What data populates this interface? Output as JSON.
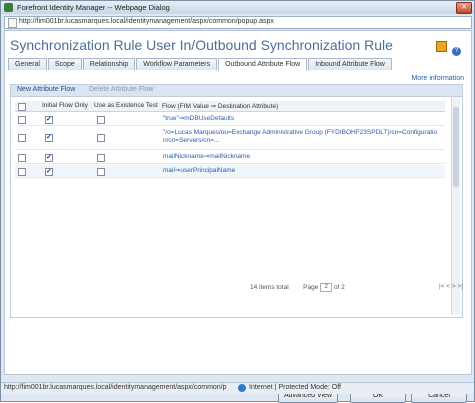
{
  "window": {
    "title": "Forefront Identity Manager -- Webpage Dialog",
    "address": "http://fim001br.lucasmarques.local/identitymanagement/aspx/common/popup.aspx",
    "close_glyph": "✕"
  },
  "page": {
    "heading": "Synchronization Rule User In/Outbound Synchronization Rule",
    "more_info": "More information"
  },
  "tabs": [
    {
      "label": "General"
    },
    {
      "label": "Scope"
    },
    {
      "label": "Relationship"
    },
    {
      "label": "Workflow Parameters"
    },
    {
      "label": "Outbound Attribute Flow",
      "active": true
    },
    {
      "label": "Inbound Attribute Flow"
    }
  ],
  "toolbar": {
    "new_label": "New Attribute Flow",
    "delete_label": "Delete Attribute Flow"
  },
  "grid": {
    "headers": {
      "initial": "Initial Flow Only",
      "existence": "Use as Existence Test",
      "flow": "Flow (FIM Value ⇒ Destination Attribute)"
    },
    "rows": [
      {
        "initial": true,
        "existence": false,
        "flow": "\"true\"⇒mDBUseDefaults"
      },
      {
        "initial": true,
        "existence": false,
        "flow": "\"/o=Lucas Marques/ou=Exchange Administrative Group (FYDIBOHF23SPDLT)/cn=Configuratio n/cn=Servers/cn=..."
      },
      {
        "initial": true,
        "existence": false,
        "flow": "mailNickname⇒mailNickname"
      },
      {
        "initial": true,
        "existence": false,
        "flow": "mail⇒userPrincipalName"
      }
    ]
  },
  "pager": {
    "total": "14 items total",
    "page_label": "Page",
    "page_value": "2",
    "of_label": "of 2",
    "nav": "|< <  > >|"
  },
  "buttons": {
    "advanced": "Advanced View",
    "ok": "OK",
    "cancel": "Cancel"
  },
  "status": {
    "url": "http://fim001br.lucasmarques.local/identitymanagement/aspx/common/p",
    "zone": "Internet | Protected Mode: Off"
  },
  "colors": {
    "accent": "#4a6f98",
    "link": "#2a5ea8"
  },
  "icons": [
    "page-icon",
    "close-icon",
    "folder-icon",
    "help-icon",
    "globe-icon",
    "checkbox-icon"
  ]
}
